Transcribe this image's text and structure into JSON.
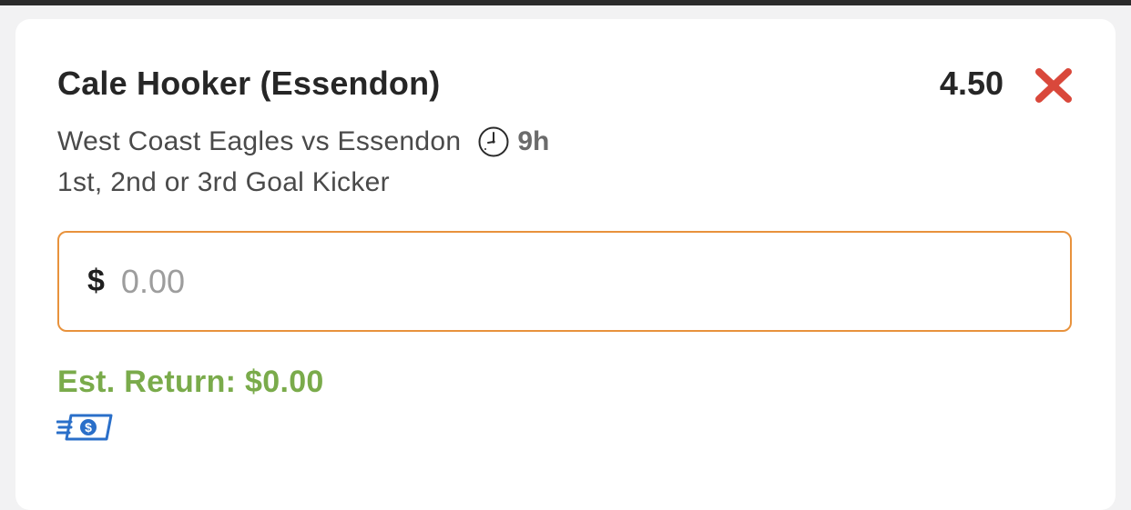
{
  "bet_slip": {
    "selection": "Cale Hooker (Essendon)",
    "odds": "4.50",
    "remove_icon": "close-x-icon",
    "event": "West Coast Eagles vs Essendon",
    "clock_icon": "clock-icon",
    "time_to_start": "9h",
    "market": "1st, 2nd or 3rd Goal Kicker",
    "stake": {
      "currency_symbol": "$",
      "value": "",
      "placeholder": "0.00"
    },
    "est_return": "Est. Return: $0.00",
    "cash_icon": "fast-cash-icon"
  },
  "colors": {
    "remove": "#d9483b",
    "input_border": "#e8923c",
    "est_return": "#7aab4b",
    "cash_icon": "#2a6fc9"
  }
}
